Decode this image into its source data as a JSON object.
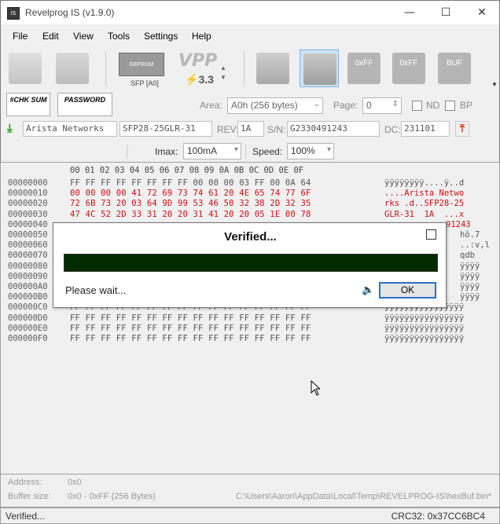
{
  "window": {
    "title": "Revelprog IS (v1.9.0)",
    "minimize": "—",
    "maximize": "☐",
    "close": "✕"
  },
  "menu": [
    "File",
    "Edit",
    "View",
    "Tools",
    "Settings",
    "Help"
  ],
  "toolbar": {
    "chip_label": "SFP [A0]",
    "chip_text": "EEPROM",
    "vpp_text": "VPP",
    "vpp_value": "3.3",
    "buttons": [
      "0xFF",
      "0xFF",
      "BUF"
    ]
  },
  "options": {
    "chksum_label": "#CHK SUM",
    "password_label": "PASSWORD",
    "area_label": "Area:",
    "area_value": "A0h (256 bytes)",
    "page_label": "Page:",
    "page_value": "0",
    "nd_label": "ND",
    "bp_label": "BP"
  },
  "info": {
    "vendor": "Arista Networks",
    "part": "SFP28-25GLR-31",
    "rev_label": "REV:",
    "rev": "1A",
    "sn_label": "S/N:",
    "sn": "G2330491243",
    "dc_label": "DC:",
    "dc": "231101"
  },
  "power": {
    "imax_label": "Imax:",
    "imax_value": "100mA",
    "speed_label": "Speed:",
    "speed_value": "100%"
  },
  "hex": {
    "header": "00 01 02 03 04 05 06 07 08 09 0A 0B 0C 0D 0E 0F",
    "rows": [
      {
        "addr": "00000000",
        "bytes": "FF FF FF FF FF FF FF FF 00 00 00 03 FF 00 0A 64",
        "ascii": "ÿÿÿÿÿÿÿÿ....ÿ..d"
      },
      {
        "addr": "00000010",
        "bytes": "00 00 00 00 41 72 69 73 74 61 20 4E 65 74 77 6F",
        "ascii": "....Arista Netwo"
      },
      {
        "addr": "00000020",
        "bytes": "72 6B 73 20 03 64 9D 99 53 46 50 32 38 2D 32 35",
        "ascii": "rks .d..SFP28-25"
      },
      {
        "addr": "00000030",
        "bytes": "47 4C 52 2D 33 31 20 20 31 41 20 20 05 1E 00 78",
        "ascii": "GLR-31  1A  ...x"
      },
      {
        "addr": "00000040",
        "bytes": "",
        "ascii": "91243"
      },
      {
        "addr": "00000050",
        "bytes": "",
        "ascii": "hŏ.7"
      },
      {
        "addr": "00000060",
        "bytes": "",
        "ascii": "..:v,l"
      },
      {
        "addr": "00000070",
        "bytes": "",
        "ascii": "qdb"
      },
      {
        "addr": "00000080",
        "bytes": "",
        "ascii": "ÿÿÿÿ"
      },
      {
        "addr": "00000090",
        "bytes": "",
        "ascii": "ÿÿÿÿ"
      },
      {
        "addr": "000000A0",
        "bytes": "",
        "ascii": "ÿÿÿÿ"
      },
      {
        "addr": "000000B0",
        "bytes": "",
        "ascii": "ÿÿÿÿ"
      },
      {
        "addr": "000000C0",
        "bytes": "FF FF FF FF FF FF FF FF FF FF FF FF FF FF FF FF",
        "ascii": "ÿÿÿÿÿÿÿÿÿÿÿÿÿÿÿÿ"
      },
      {
        "addr": "000000D0",
        "bytes": "FF FF FF FF FF FF FF FF FF FF FF FF FF FF FF FF",
        "ascii": "ÿÿÿÿÿÿÿÿÿÿÿÿÿÿÿÿ"
      },
      {
        "addr": "000000E0",
        "bytes": "FF FF FF FF FF FF FF FF FF FF FF FF FF FF FF FF",
        "ascii": "ÿÿÿÿÿÿÿÿÿÿÿÿÿÿÿÿ"
      },
      {
        "addr": "000000F0",
        "bytes": "FF FF FF FF FF FF FF FF FF FF FF FF FF FF FF FF",
        "ascii": "ÿÿÿÿÿÿÿÿÿÿÿÿÿÿÿÿ"
      }
    ]
  },
  "dialog": {
    "title": "Verified...",
    "message": "Please wait...",
    "ok_label": "OK",
    "progress": 1.0,
    "progress_color": "#022b00"
  },
  "status": {
    "address_label": "Address:",
    "address_value": "0x0",
    "buffer_label": "Buffer size:",
    "buffer_value": "0x0 - 0xFF (256 Bytes)",
    "path": "C:\\Users\\Aaron\\AppData\\Local\\Temp\\REVELPROG-IS\\hexBuf.bin*",
    "text": "Verified...",
    "crc": "CRC32: 0x37CC6BC4"
  }
}
